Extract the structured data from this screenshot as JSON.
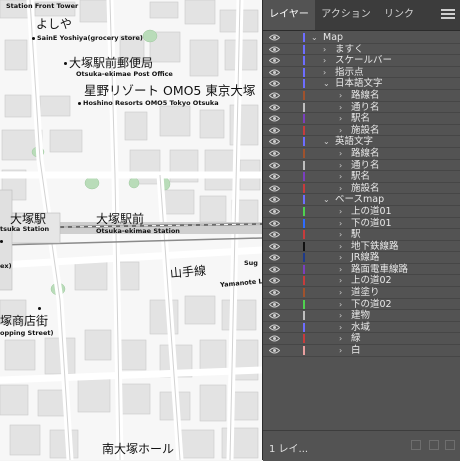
{
  "map": {
    "labels": {
      "station_front_tower": "Station Front Tower",
      "yoshiya_jp": "よしや",
      "yoshiya_en": "SainE Yoshiya(grocery store)",
      "post_office_jp": "大塚駅前郵便局",
      "post_office_en": "Otsuka-ekimae Post Office",
      "hotel_jp": "星野リゾート OMO5 東京大塚",
      "hotel_en": "Hoshino Resorts OMO5 Tokyo Otsuka",
      "otsuka_station_jp": "大塚駅",
      "otsuka_station_en": "tsuka Station",
      "ekimae_station_jp": "大塚駅前",
      "ekimae_station_en": "Otsuka-ekimae Station",
      "yamanote_jp": "山手線",
      "yamanote_en": "Yamanote Li",
      "sug_label": "Sug",
      "shopping_jp": "塚商店街",
      "shopping_en": "opping Street)",
      "edge_ex": "ex)",
      "minami_hall_jp": "南大塚ホール"
    }
  },
  "panel": {
    "tabs": [
      {
        "label": "レイヤー",
        "active": true
      },
      {
        "label": "アクション",
        "active": false
      },
      {
        "label": "リンク",
        "active": false
      }
    ],
    "footer_text": "1 レイ..."
  },
  "layers": [
    {
      "name": "Map",
      "level": 0,
      "arrow": "⌄",
      "color": "#6d6dff"
    },
    {
      "name": "ますく",
      "level": 1,
      "arrow": "›",
      "color": "#6d6dff"
    },
    {
      "name": "スケールバー",
      "level": 1,
      "arrow": "›",
      "color": "#6d6dff"
    },
    {
      "name": "指示点",
      "level": 1,
      "arrow": "›",
      "color": "#6d6dff"
    },
    {
      "name": "日本語文字",
      "level": 1,
      "arrow": "⌄",
      "color": "#6d6dff"
    },
    {
      "name": "路線名",
      "level": 2,
      "arrow": "›",
      "color": "#a0522d"
    },
    {
      "name": "通り名",
      "level": 2,
      "arrow": "›",
      "color": "#bfbfbf"
    },
    {
      "name": "駅名",
      "level": 2,
      "arrow": "›",
      "color": "#7a3fbf"
    },
    {
      "name": "施設名",
      "level": 2,
      "arrow": "›",
      "color": "#c73c3c"
    },
    {
      "name": "英語文字",
      "level": 1,
      "arrow": "⌄",
      "color": "#6d6dff"
    },
    {
      "name": "路線名",
      "level": 2,
      "arrow": "›",
      "color": "#a0522d"
    },
    {
      "name": "通り名",
      "level": 2,
      "arrow": "›",
      "color": "#bfbfbf"
    },
    {
      "name": "駅名",
      "level": 2,
      "arrow": "›",
      "color": "#7a3fbf"
    },
    {
      "name": "施設名",
      "level": 2,
      "arrow": "›",
      "color": "#c73c3c"
    },
    {
      "name": "ベースmap",
      "level": 1,
      "arrow": "⌄",
      "color": "#6d6dff"
    },
    {
      "name": "上の道01",
      "level": 2,
      "arrow": "›",
      "color": "#4fd14f"
    },
    {
      "name": "下の道01",
      "level": 2,
      "arrow": "›",
      "color": "#2d6cff"
    },
    {
      "name": "駅",
      "level": 2,
      "arrow": "›",
      "color": "#c73c3c"
    },
    {
      "name": "地下鉄線路",
      "level": 2,
      "arrow": "›",
      "color": "#111111"
    },
    {
      "name": "JR線路",
      "level": 2,
      "arrow": "›",
      "color": "#1e3a8a"
    },
    {
      "name": "路面電車線路",
      "level": 2,
      "arrow": "›",
      "color": "#7a3fbf"
    },
    {
      "name": "上の道02",
      "level": 2,
      "arrow": "›",
      "color": "#c73c3c"
    },
    {
      "name": "道塗り",
      "level": 2,
      "arrow": "›",
      "color": "#a0522d"
    },
    {
      "name": "下の道02",
      "level": 2,
      "arrow": "›",
      "color": "#4fd14f"
    },
    {
      "name": "建物",
      "level": 2,
      "arrow": "›",
      "color": "#bfbfbf"
    },
    {
      "name": "水域",
      "level": 2,
      "arrow": "›",
      "color": "#6d6dff"
    },
    {
      "name": "緑",
      "level": 2,
      "arrow": "›",
      "color": "#c73c3c"
    },
    {
      "name": "白",
      "level": 2,
      "arrow": "›",
      "color": "#e8a0a0"
    }
  ]
}
